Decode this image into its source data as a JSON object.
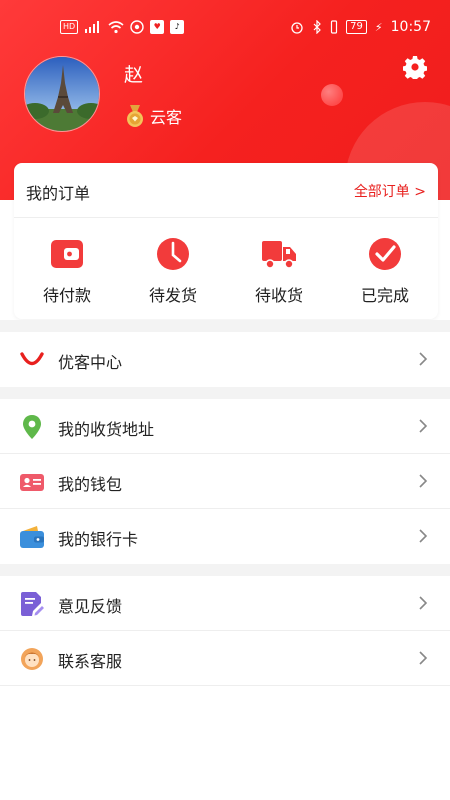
{
  "status_bar": {
    "icons_left": [
      "hd-icon",
      "signal-4g-icon",
      "wifi-icon",
      "app-icon",
      "app-badge-icon",
      "tiktok-icon"
    ],
    "icons_right": [
      "alarm-icon",
      "bluetooth-icon",
      "vibrate-icon"
    ],
    "hd_label": "HD",
    "battery": "79",
    "time": "10:57"
  },
  "profile": {
    "name": "赵",
    "level": "云客",
    "level_icon": "medal-icon",
    "settings_icon": "gear-icon"
  },
  "orders": {
    "title": "我的订单",
    "all_link": "全部订单 >",
    "items": [
      {
        "label": "待付款",
        "icon": "wallet-icon"
      },
      {
        "label": "待发货",
        "icon": "clock-icon"
      },
      {
        "label": "待收货",
        "icon": "truck-icon"
      },
      {
        "label": "已完成",
        "icon": "check-icon"
      }
    ]
  },
  "menu": {
    "vip_center": "优客中心",
    "address": "我的收货地址",
    "wallet": "我的钱包",
    "bank_card": "我的银行卡",
    "feedback": "意见反馈",
    "service": "联系客服"
  },
  "colors": {
    "brand_red": "#f5211f",
    "link_red": "#e8201e",
    "separator": "#f3f3f3"
  }
}
